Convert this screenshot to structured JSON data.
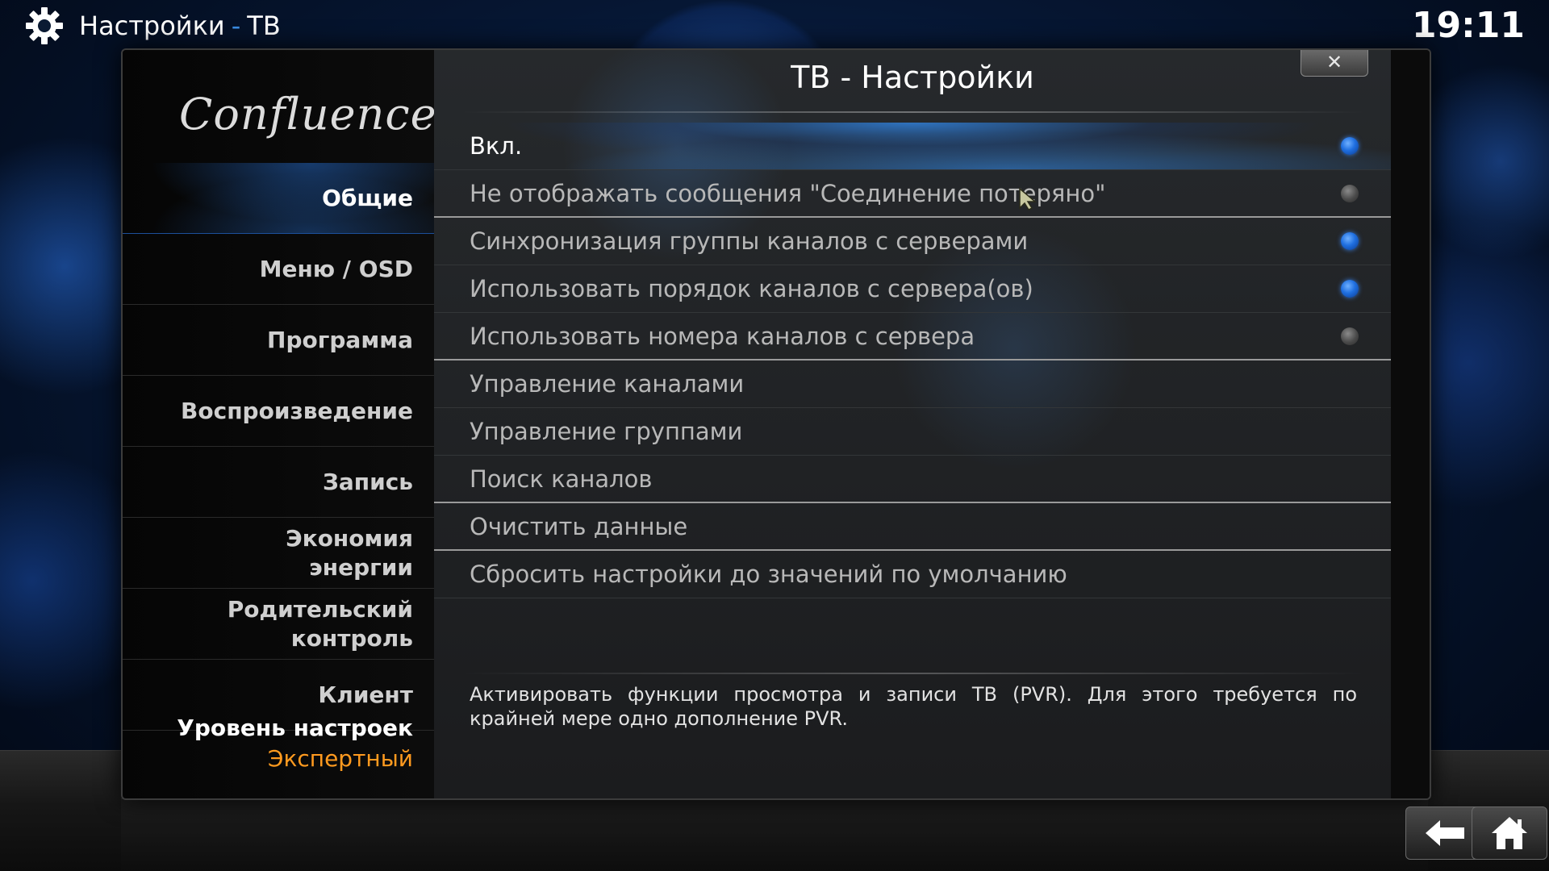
{
  "header": {
    "section": "Настройки",
    "separator": "-",
    "subsection": "ТВ",
    "clock": "19:11"
  },
  "dialog": {
    "title": "ТВ - Настройки",
    "close_label": "✕",
    "logo_text": "Confluence"
  },
  "sidebar": {
    "items": [
      {
        "label": "Общие",
        "active": true
      },
      {
        "label": "Меню / OSD",
        "active": false
      },
      {
        "label": "Программа",
        "active": false
      },
      {
        "label": "Воспроизведение",
        "active": false
      },
      {
        "label": "Запись",
        "active": false
      },
      {
        "line1": "Экономия",
        "line2": "энергии",
        "active": false
      },
      {
        "line1": "Родительский",
        "line2": "контроль",
        "active": false
      },
      {
        "label": "Клиент",
        "active": false
      }
    ],
    "level_title": "Уровень настроек",
    "level_value": "Экспертный"
  },
  "settings": [
    {
      "label": "Вкл.",
      "toggle": "on",
      "selected": true
    },
    {
      "label": "Не отображать сообщения \"Соединение потеряно\"",
      "toggle": "off"
    },
    {
      "label": "Синхронизация группы каналов с серверами",
      "toggle": "on"
    },
    {
      "label": "Использовать порядок каналов с сервера(ов)",
      "toggle": "on"
    },
    {
      "label": "Использовать номера каналов с сервера",
      "toggle": "off"
    },
    {
      "label": "Управление каналами"
    },
    {
      "label": "Управление группами"
    },
    {
      "label": "Поиск каналов"
    },
    {
      "label": "Очистить данные"
    },
    {
      "label": "Сбросить настройки до значений по умолчанию"
    }
  ],
  "help_text": "Активировать функции просмотра и записи ТВ (PVR). Для этого требуется по крайней мере одно дополнение PVR.",
  "colors": {
    "accent_blue": "#1f6fe0",
    "level_orange": "#ff9a1f",
    "header_separator": "#3b8de6"
  },
  "icons": {
    "settings": "gear-icon",
    "back": "back-arrow-icon",
    "home": "home-icon"
  }
}
